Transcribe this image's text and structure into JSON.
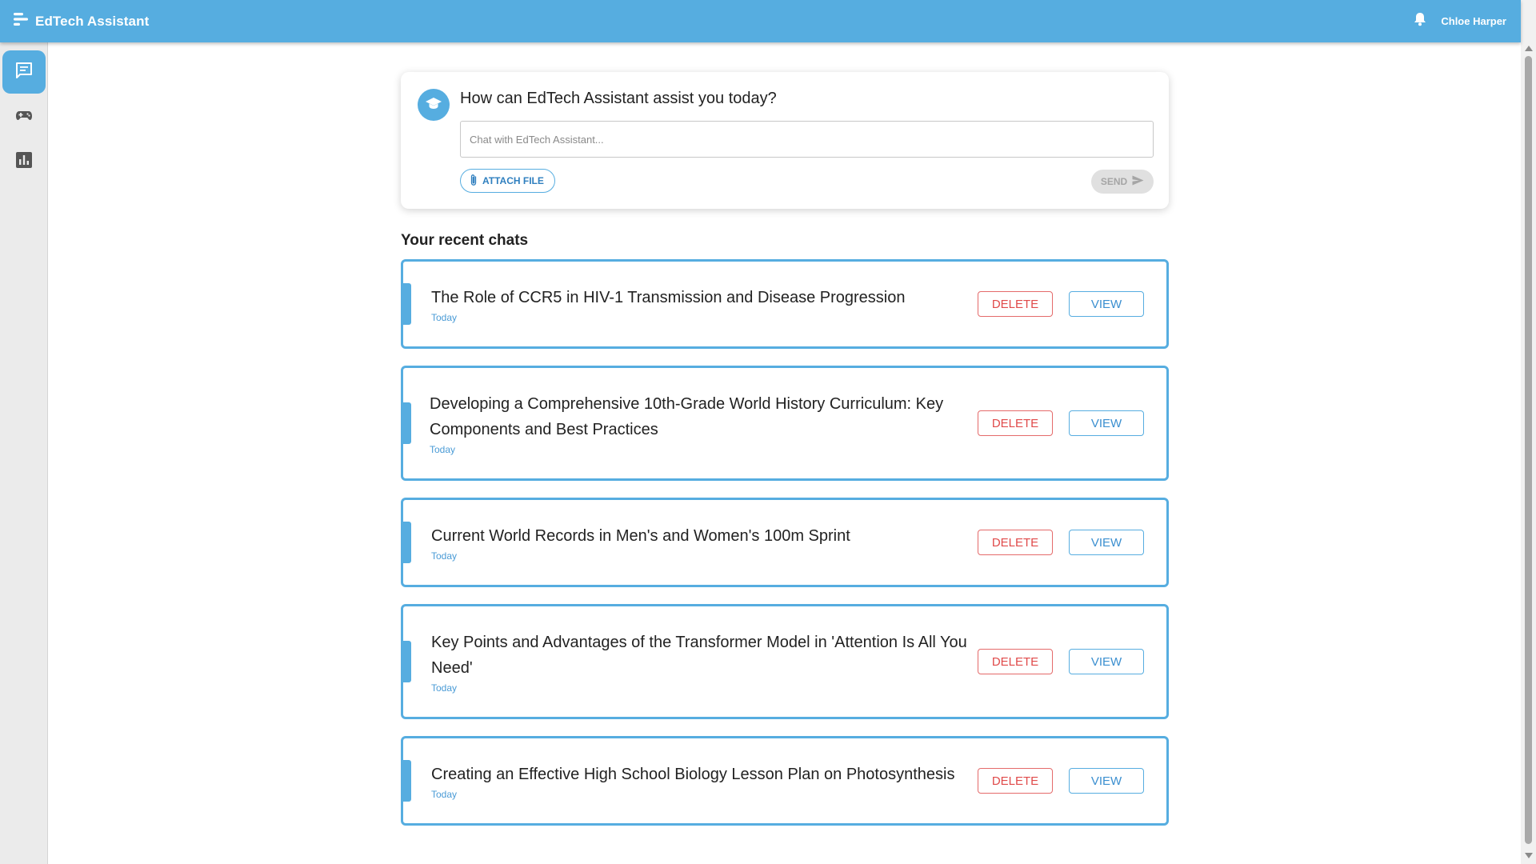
{
  "header": {
    "app_title": "EdTech Assistant",
    "user_name": "Chloe Harper",
    "colors": {
      "bar": "#56ade0"
    }
  },
  "sidebar": {
    "items": [
      {
        "icon": "chat-icon",
        "active": true
      },
      {
        "icon": "gamepad-icon",
        "active": false
      },
      {
        "icon": "bar-chart-icon",
        "active": false
      }
    ]
  },
  "composer": {
    "prompt": "How can EdTech Assistant assist you today?",
    "placeholder": "Chat with EdTech Assistant...",
    "value": "",
    "attach_label": "ATTACH FILE",
    "send_label": "SEND"
  },
  "recent": {
    "title": "Your recent chats",
    "delete_label": "DELETE",
    "view_label": "VIEW",
    "chats": [
      {
        "title": "The Role of CCR5 in HIV-1 Transmission and Disease Progression",
        "date": "Today"
      },
      {
        "title": "Developing a Comprehensive 10th-Grade World History Curriculum: Key Components and Best Practices",
        "date": "Today"
      },
      {
        "title": "Current World Records in Men's and Women's 100m Sprint",
        "date": "Today"
      },
      {
        "title": "Key Points and Advantages of the Transformer Model in 'Attention Is All You Need'",
        "date": "Today"
      },
      {
        "title": "Creating an Effective High School Biology Lesson Plan on Photosynthesis",
        "date": "Today"
      }
    ]
  }
}
